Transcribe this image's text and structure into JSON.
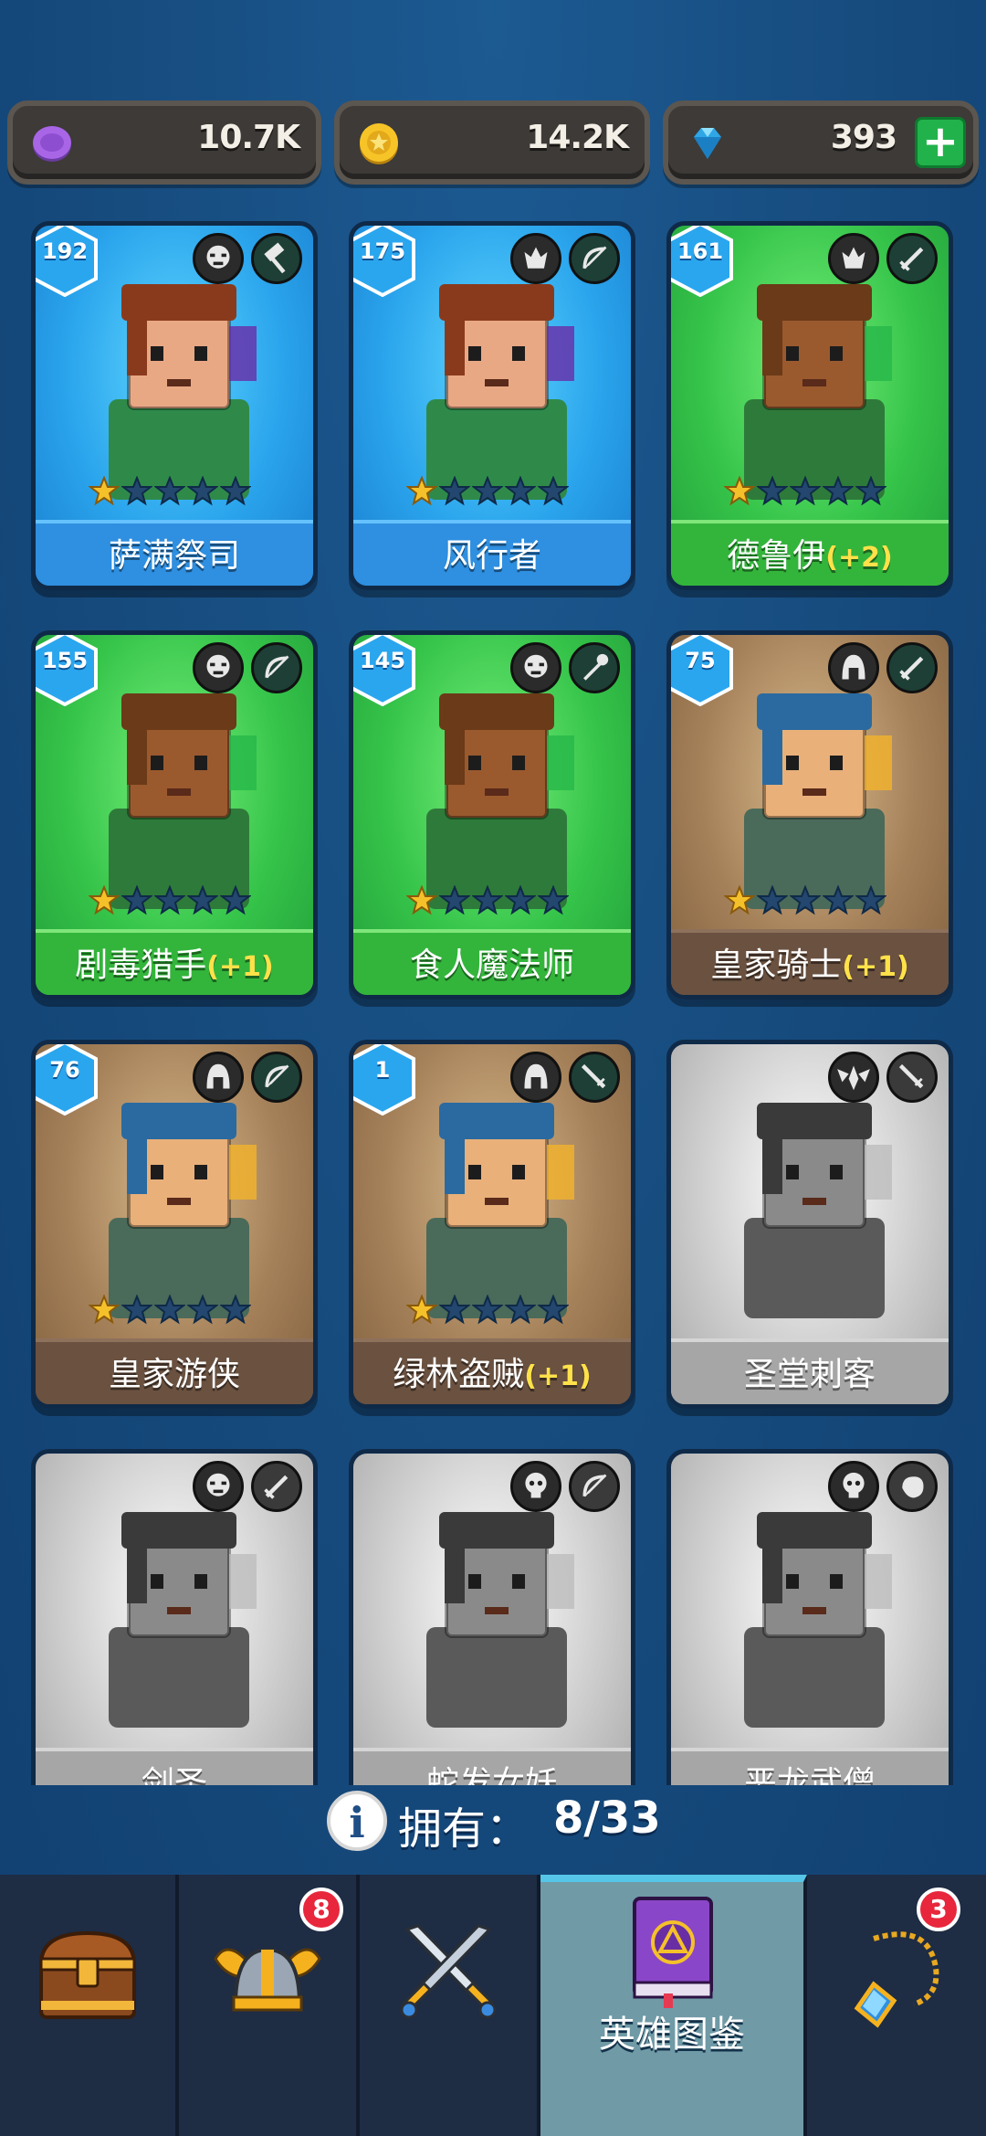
{
  "currencies": [
    {
      "id": "purple-coin",
      "value": "10.7K",
      "color": "#9a5cd6"
    },
    {
      "id": "gold-coin",
      "value": "14.2K",
      "color": "#f5c12a"
    },
    {
      "id": "gem",
      "value": "393",
      "color": "#3fb8f0",
      "add_label": "+"
    }
  ],
  "heroes": [
    {
      "name": "萨满祭司",
      "plus": "",
      "level": "192",
      "bg": "blue",
      "stars": 1,
      "class_icon": "orc-icon",
      "weapon_icon": "hammer-icon",
      "owned": true
    },
    {
      "name": "风行者",
      "plus": "",
      "level": "175",
      "bg": "blue",
      "stars": 1,
      "class_icon": "elf-icon",
      "weapon_icon": "bow-icon",
      "owned": true
    },
    {
      "name": "德鲁伊",
      "plus": "(+2)",
      "level": "161",
      "bg": "green",
      "stars": 1,
      "class_icon": "elf-icon",
      "weapon_icon": "sword-icon",
      "owned": true
    },
    {
      "name": "剧毒猎手",
      "plus": "(+1)",
      "level": "155",
      "bg": "green",
      "stars": 1,
      "class_icon": "orc-icon",
      "weapon_icon": "bow-icon",
      "owned": true
    },
    {
      "name": "食人魔法师",
      "plus": "",
      "level": "145",
      "bg": "green",
      "stars": 1,
      "class_icon": "orc-icon",
      "weapon_icon": "staff-icon",
      "owned": true
    },
    {
      "name": "皇家骑士",
      "plus": "(+1)",
      "level": "75",
      "bg": "brown",
      "stars": 1,
      "class_icon": "helmet-icon",
      "weapon_icon": "sword-icon",
      "owned": true
    },
    {
      "name": "皇家游侠",
      "plus": "",
      "level": "76",
      "bg": "brown",
      "stars": 1,
      "class_icon": "helmet-icon",
      "weapon_icon": "bow-icon",
      "owned": true
    },
    {
      "name": "绿林盗贼",
      "plus": "(+1)",
      "level": "1",
      "bg": "brown",
      "stars": 1,
      "class_icon": "helmet-icon",
      "weapon_icon": "dagger-icon",
      "owned": true
    },
    {
      "name": "圣堂刺客",
      "plus": "",
      "level": "",
      "bg": "gray",
      "stars": 0,
      "class_icon": "winged-icon",
      "weapon_icon": "dagger-icon",
      "owned": false
    },
    {
      "name": "剑圣",
      "plus": "",
      "level": "",
      "bg": "gray",
      "stars": 0,
      "class_icon": "orc-icon",
      "weapon_icon": "sword-icon",
      "owned": false
    },
    {
      "name": "蛇发女妖",
      "plus": "",
      "level": "",
      "bg": "gray",
      "stars": 0,
      "class_icon": "skull-icon",
      "weapon_icon": "bow-icon",
      "owned": false
    },
    {
      "name": "恶龙武僧",
      "plus": "",
      "level": "",
      "bg": "gray",
      "stars": 0,
      "class_icon": "skull-icon",
      "weapon_icon": "fist-icon",
      "owned": false
    }
  ],
  "owned": {
    "label": "拥有：",
    "value": "8/33"
  },
  "nav": [
    {
      "id": "chest",
      "icon": "treasure-chest-icon",
      "label": "",
      "badge": ""
    },
    {
      "id": "heroes",
      "icon": "viking-helmet-icon",
      "label": "",
      "badge": "8"
    },
    {
      "id": "battle",
      "icon": "crossed-swords-icon",
      "label": "",
      "badge": ""
    },
    {
      "id": "codex",
      "icon": "spellbook-icon",
      "label": "英雄图鉴",
      "badge": "",
      "active": true
    },
    {
      "id": "items",
      "icon": "amulet-icon",
      "label": "",
      "badge": "3"
    }
  ]
}
